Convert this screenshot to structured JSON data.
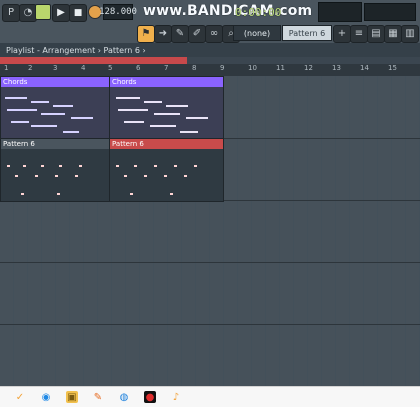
{
  "toolbar": {
    "tempo": "128.000",
    "watermark": "www.BANDICAM.com",
    "time": "0:00:00",
    "pattern_select": "Pattern 6",
    "none_select": "(none)"
  },
  "playlist": {
    "breadcrumb": [
      "Playlist",
      "Arrangement",
      "Pattern 6"
    ],
    "ruler": [
      "1",
      "2",
      "3",
      "4",
      "5",
      "6",
      "7",
      "8",
      "9",
      "10",
      "11",
      "12",
      "13",
      "14",
      "15"
    ]
  },
  "clips": {
    "chords_left": "Chords",
    "chords_right": "Chords",
    "pattern_left": "Pattern 6",
    "pattern_right": "Pattern 6"
  },
  "taskbar": {
    "icons": [
      "check-icon",
      "chrome-icon",
      "file-explorer-icon",
      "paint-icon",
      "edge-icon",
      "recorder-icon",
      "fl-icon"
    ]
  },
  "colors": {
    "accent": "#8a63ff",
    "pattern": "#c84b4b"
  }
}
